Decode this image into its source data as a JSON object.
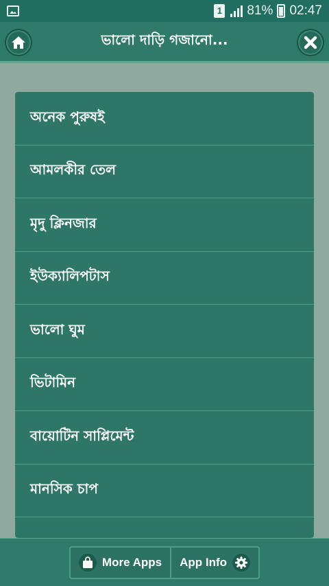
{
  "status_bar": {
    "sim": "1",
    "battery": "81%",
    "time": "02:47"
  },
  "header": {
    "title": "ভালো দাড়ি গজানো..."
  },
  "list": {
    "items": [
      "অনেক পুরুষই",
      "আমলকীর তেল",
      "মৃদু ক্লিনজার",
      "ইউক্যালিপটাস",
      "ভালো ঘুম",
      "ভিটামিন",
      "বায়োটিন সাপ্লিমেন্ট",
      "মানসিক চাপ"
    ]
  },
  "bottom_bar": {
    "more_apps": "More Apps",
    "app_info": "App Info"
  },
  "colors": {
    "status_bar": "#1f6e5f",
    "header": "#2f7a68",
    "card": "#2e7767",
    "background": "#8fa9a0"
  }
}
